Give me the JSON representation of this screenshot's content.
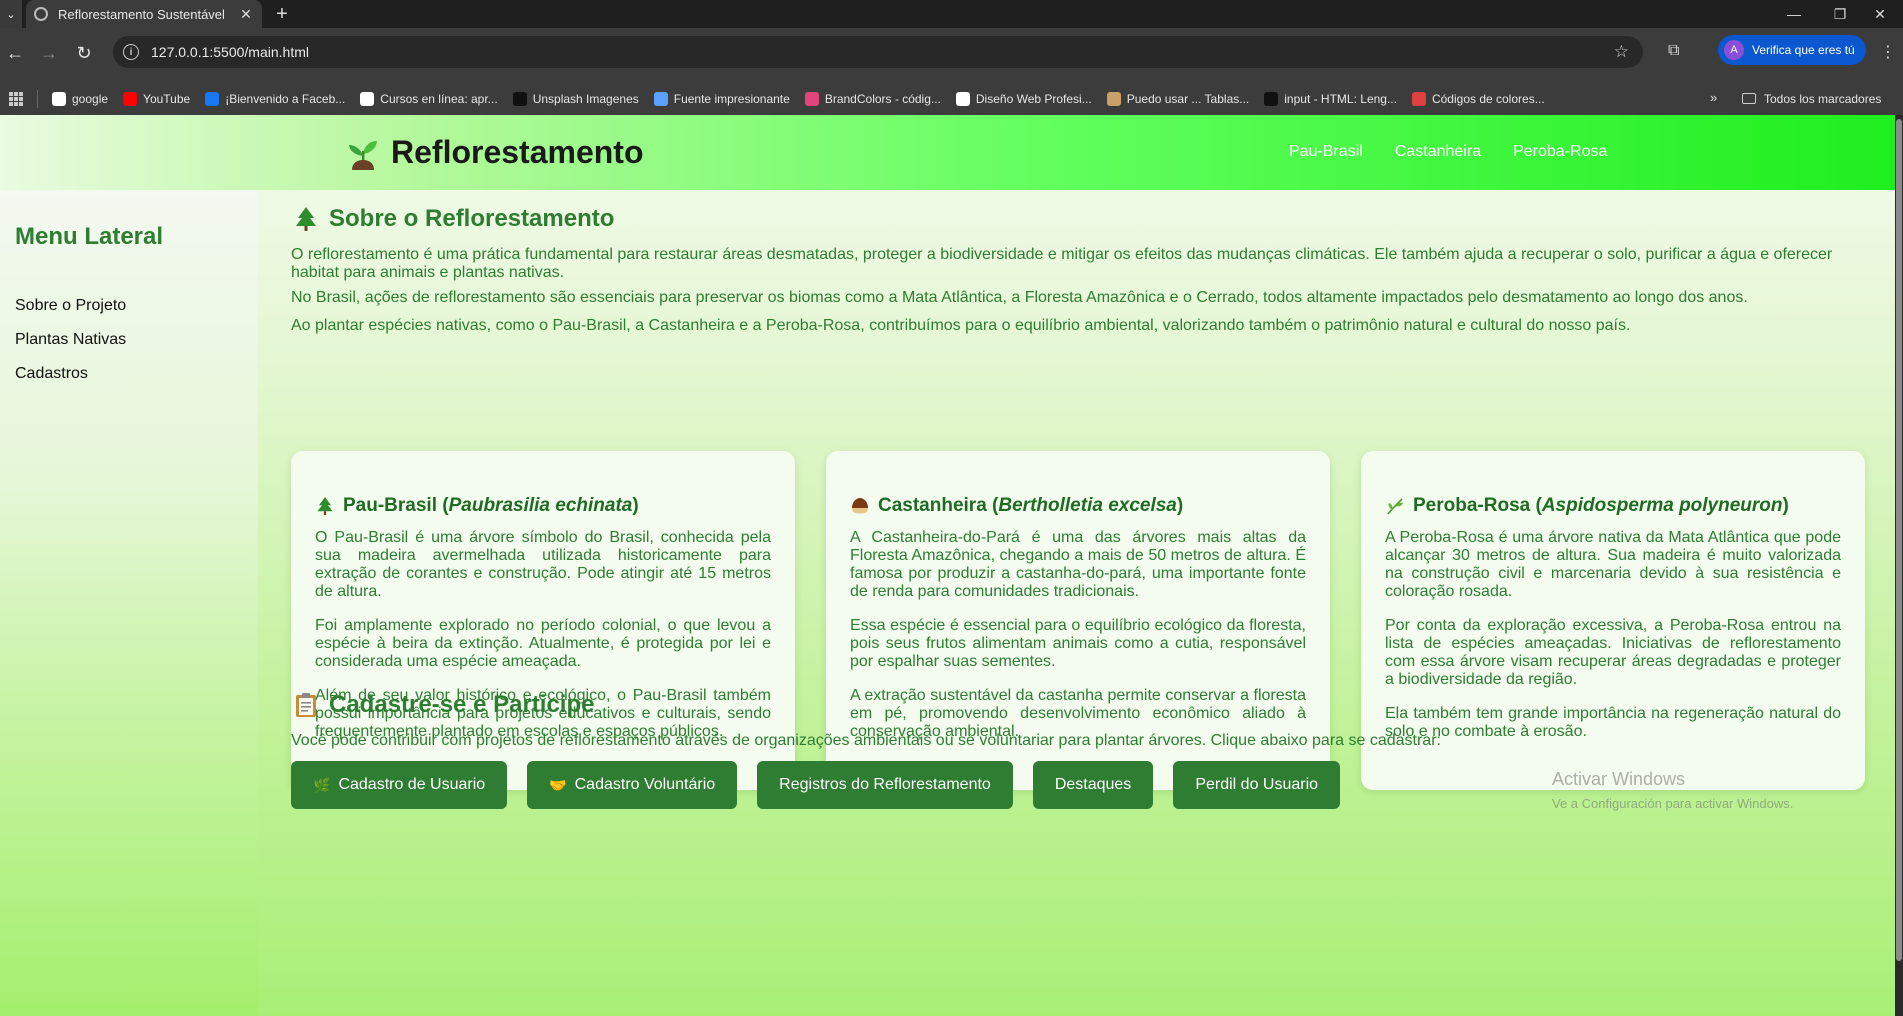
{
  "browser": {
    "tab_title": "Reflorestamento Sustentável",
    "new_tab": "+",
    "url": "127.0.0.1:5500/main.html",
    "profile_label": "Verifica que eres tú",
    "profile_initial": "A",
    "window_controls": {
      "minimize": "—",
      "restore": "❐",
      "close": "✕"
    }
  },
  "bookmarks": {
    "items": [
      {
        "label": "google",
        "icon": "google-icon",
        "color": "#ffffff"
      },
      {
        "label": "YouTube",
        "icon": "youtube-icon",
        "color": "#ff0000"
      },
      {
        "label": "¡Bienvenido a Faceb...",
        "icon": "facebook-icon",
        "color": "#1877f2"
      },
      {
        "label": "Cursos en línea: apr...",
        "icon": "udemy-icon",
        "color": "#ffffff"
      },
      {
        "label": "Unsplash Imagenes",
        "icon": "unsplash-icon",
        "color": "#111111"
      },
      {
        "label": "Fuente impresionante",
        "icon": "flag-icon",
        "color": "#5aa0ff"
      },
      {
        "label": "BrandColors - códig...",
        "icon": "brandcolors-icon",
        "color": "#e0457b"
      },
      {
        "label": "Diseño Web Profesi...",
        "icon": "udemy-icon",
        "color": "#ffffff"
      },
      {
        "label": "Puedo usar ... Tablas...",
        "icon": "caniuse-icon",
        "color": "#c9a06a"
      },
      {
        "label": "input - HTML: Leng...",
        "icon": "mdn-icon",
        "color": "#111111"
      },
      {
        "label": "Códigos de colores...",
        "icon": "colorwheel-icon",
        "color": "#e04040"
      }
    ],
    "more": "»",
    "all_bookmarks": "Todos los marcadores"
  },
  "header": {
    "brand": "Reflorestamento",
    "nav": [
      "Pau-Brasil",
      "Castanheira",
      "Peroba-Rosa"
    ]
  },
  "sidebar": {
    "title": "Menu Lateral",
    "links": [
      "Sobre o Projeto",
      "Plantas Nativas",
      "Cadastros"
    ]
  },
  "about": {
    "title": "Sobre o Reflorestamento",
    "paragraphs": [
      "O reflorestamento é uma prática fundamental para restaurar áreas desmatadas, proteger a biodiversidade e mitigar os efeitos das mudanças climáticas. Ele também ajuda a recuperar o solo, purificar a água e oferecer habitat para animais e plantas nativas.",
      "No Brasil, ações de reflorestamento são essenciais para preservar os biomas como a Mata Atlântica, a Floresta Amazônica e o Cerrado, todos altamente impactados pelo desmatamento ao longo dos anos.",
      "Ao plantar espécies nativas, como o Pau-Brasil, a Castanheira e a Peroba-Rosa, contribuímos para o equilíbrio ambiental, valorizando também o patrimônio natural e cultural do nosso país."
    ]
  },
  "cards": [
    {
      "name": "Pau-Brasil",
      "scientific": "Paubrasilia echinata",
      "icon": "evergreen-tree-icon",
      "paragraphs": [
        "O Pau-Brasil é uma árvore símbolo do Brasil, conhecida pela sua madeira avermelhada utilizada historicamente para extração de corantes e construção. Pode atingir até 15 metros de altura.",
        "Foi amplamente explorado no período colonial, o que levou a espécie à beira da extinção. Atualmente, é protegida por lei e considerada uma espécie ameaçada.",
        "Além de seu valor histórico e ecológico, o Pau-Brasil também possui importância para projetos educativos e culturais, sendo frequentemente plantado em escolas e espaços públicos."
      ]
    },
    {
      "name": "Castanheira",
      "scientific": "Bertholletia excelsa",
      "icon": "chestnut-icon",
      "paragraphs": [
        "A Castanheira-do-Pará é uma das árvores mais altas da Floresta Amazônica, chegando a mais de 50 metros de altura. É famosa por produzir a castanha-do-pará, uma importante fonte de renda para comunidades tradicionais.",
        "Essa espécie é essencial para o equilíbrio ecológico da floresta, pois seus frutos alimentam animais como a cutia, responsável por espalhar suas sementes.",
        "A extração sustentável da castanha permite conservar a floresta em pé, promovendo desenvolvimento econômico aliado à conservação ambiental."
      ]
    },
    {
      "name": "Peroba-Rosa",
      "scientific": "Aspidosperma polyneuron",
      "icon": "herb-icon",
      "paragraphs": [
        "A Peroba-Rosa é uma árvore nativa da Mata Atlântica que pode alcançar 30 metros de altura. Sua madeira é muito valorizada na construção civil e marcenaria devido à sua resistência e coloração rosada.",
        "Por conta da exploração excessiva, a Peroba-Rosa entrou na lista de espécies ameaçadas. Iniciativas de reflorestamento com essa árvore visam recuperar áreas degradadas e proteger a biodiversidade da região.",
        "Ela também tem grande importância na regeneração natural do solo e no combate à erosão."
      ]
    }
  ],
  "signup": {
    "title": "Cadastre-se e Participe",
    "text": "Você pode contribuir com projetos de reflorestamento através de organizações ambientais ou se voluntariar para plantar árvores. Clique abaixo para se cadastrar:",
    "buttons": [
      {
        "label": "Cadastro de Usuario",
        "icon": "🌿"
      },
      {
        "label": "Cadastro Voluntário",
        "icon": "🤝"
      },
      {
        "label": "Registros do Reflorestamento",
        "icon": ""
      },
      {
        "label": "Destaques",
        "icon": ""
      },
      {
        "label": "Perdil do Usuario",
        "icon": ""
      }
    ]
  },
  "watermark": {
    "line1": "Activar Windows",
    "line2": "Ve a Configuración para activar Windows."
  },
  "colors": {
    "primary_green": "#2e7d32",
    "header_gradient_end": "#1eee1e",
    "profile_chip": "#0b57d0"
  }
}
